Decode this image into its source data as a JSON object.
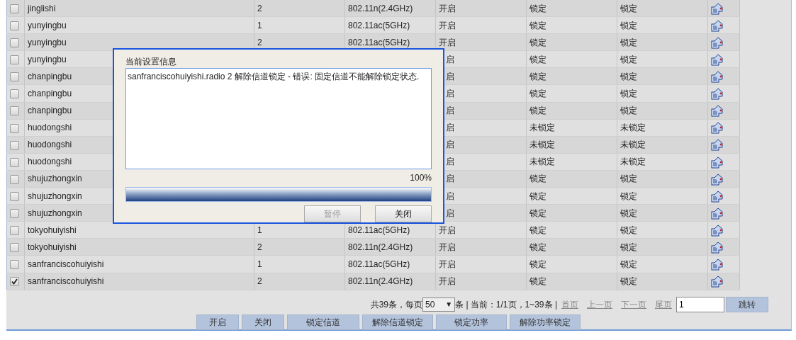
{
  "table": {
    "rows": [
      {
        "checked": false,
        "name": "jinglishi",
        "radio": "2",
        "mode": "802.11n(2.4GHz)",
        "status": "开启",
        "channel_lock": "锁定",
        "power_lock": "锁定"
      },
      {
        "checked": false,
        "name": "yunyingbu",
        "radio": "1",
        "mode": "802.11ac(5GHz)",
        "status": "开启",
        "channel_lock": "锁定",
        "power_lock": "锁定"
      },
      {
        "checked": false,
        "name": "yunyingbu",
        "radio": "2",
        "mode": "802.11ac(5GHz)",
        "status": "开启",
        "channel_lock": "锁定",
        "power_lock": "锁定"
      },
      {
        "checked": false,
        "name": "yunyingbu",
        "status": "启",
        "channel_lock": "锁定",
        "power_lock": "锁定"
      },
      {
        "checked": false,
        "name": "chanpingbu",
        "status": "启",
        "channel_lock": "锁定",
        "power_lock": "锁定"
      },
      {
        "checked": false,
        "name": "chanpingbu",
        "status": "启",
        "channel_lock": "锁定",
        "power_lock": "锁定"
      },
      {
        "checked": false,
        "name": "chanpingbu",
        "status": "启",
        "channel_lock": "锁定",
        "power_lock": "锁定"
      },
      {
        "checked": false,
        "name": "huodongshi",
        "status": "启",
        "channel_lock": "未锁定",
        "power_lock": "未锁定"
      },
      {
        "checked": false,
        "name": "huodongshi",
        "status": "启",
        "channel_lock": "未锁定",
        "power_lock": "未锁定"
      },
      {
        "checked": false,
        "name": "huodongshi",
        "status": "启",
        "channel_lock": "未锁定",
        "power_lock": "未锁定"
      },
      {
        "checked": false,
        "name": "shujuzhongxin",
        "status": "启",
        "channel_lock": "锁定",
        "power_lock": "锁定"
      },
      {
        "checked": false,
        "name": "shujuzhongxin",
        "status": "启",
        "channel_lock": "锁定",
        "power_lock": "锁定"
      },
      {
        "checked": false,
        "name": "shujuzhongxin",
        "status": "启",
        "channel_lock": "锁定",
        "power_lock": "锁定"
      },
      {
        "checked": false,
        "name": "tokyohuiyishi",
        "radio": "1",
        "mode": "802.11ac(5GHz)",
        "status": "开启",
        "channel_lock": "锁定",
        "power_lock": "锁定"
      },
      {
        "checked": false,
        "name": "tokyohuiyishi",
        "radio": "2",
        "mode": "802.11n(2.4GHz)",
        "status": "开启",
        "channel_lock": "锁定",
        "power_lock": "锁定"
      },
      {
        "checked": false,
        "name": "sanfranciscohuiyishi",
        "radio": "1",
        "mode": "802.11ac(5GHz)",
        "status": "开启",
        "channel_lock": "锁定",
        "power_lock": "锁定"
      },
      {
        "checked": true,
        "name": "sanfranciscohuiyishi",
        "radio": "2",
        "mode": "802.11n(2.4GHz)",
        "status": "开启",
        "channel_lock": "锁定",
        "power_lock": "锁定"
      }
    ]
  },
  "pagination": {
    "total": "共39条，每页",
    "page_size": "50",
    "caret": "▼",
    "info": "条 | 当前：1/1页，1~39条 |",
    "links": [
      "首页",
      "上一页",
      "下一页",
      "尾页"
    ],
    "page_input": "1",
    "go_button": "跳转"
  },
  "actions": [
    "开启",
    "关闭",
    "锁定信道",
    "解除信道锁定",
    "锁定功率",
    "解除功率锁定"
  ],
  "dialog": {
    "label": "当前设置信息",
    "message": "sanfranciscohuiyishi.radio 2 解除信道锁定 - 错误: 固定信道不能解除锁定状态.",
    "percent": "100%",
    "level": 1,
    "buttons": [
      {
        "label": "暂停",
        "disabled": true
      },
      {
        "label": "关闭",
        "disabled": false
      }
    ]
  }
}
